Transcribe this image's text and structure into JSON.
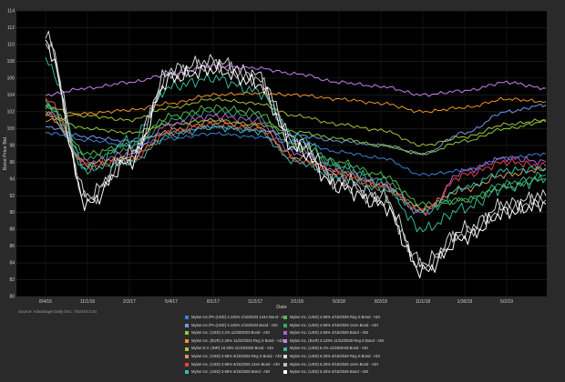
{
  "chart_data": {
    "type": "line",
    "title": "",
    "ylabel": "Bond Price Bid",
    "xlabel": "Date",
    "ylim": [
      80,
      114
    ],
    "yticks": [
      80,
      82,
      84,
      86,
      88,
      90,
      92,
      94,
      96,
      98,
      100,
      102,
      104,
      106,
      108,
      110,
      112,
      114
    ],
    "xticks": [
      "8/4/16",
      "11/1/16",
      "2/2/17",
      "5/4/17",
      "8/1/17",
      "11/2/17",
      "2/1/18",
      "5/3/18",
      "8/2/18",
      "11/1/18",
      "1/30/19",
      "5/2/19"
    ],
    "grid": true,
    "legend_placement": "bottom",
    "source": "Source: Advantage Daily Doc. 7/24/19 3:34",
    "x": [
      "8/4/16",
      "11/1/16",
      "2/2/17",
      "5/4/17",
      "8/1/17",
      "11/2/17",
      "2/1/18",
      "5/3/18",
      "8/2/18",
      "11/1/18",
      "1/30/19",
      "5/2/19",
      "7/23/19"
    ],
    "series": [
      {
        "name": "Mylan Inc./PA (USD) 3.125% 1/15/2023 144A Bond - ADI",
        "color": "#3f7fd9",
        "values": [
          99.5,
          98.6,
          98.0,
          98.8,
          99.4,
          99.0,
          98.5,
          97.2,
          96.5,
          94.5,
          95.0,
          96.5,
          97.0
        ]
      },
      {
        "name": "Mylan Inc. (USD) 4.55% 4/15/2028 Reg S Bond - ADI",
        "color": "#57b84f",
        "values": [
          103.0,
          97.0,
          98.0,
          101.5,
          102.5,
          102.0,
          98.0,
          96.0,
          94.5,
          91.0,
          91.5,
          93.0,
          94.0
        ]
      },
      {
        "name": "Mylan Inc./PA (USD) 3.125% 1/15/2023 Bond - ADI",
        "color": "#6f9ae6",
        "values": [
          100.2,
          99.0,
          98.5,
          99.5,
          100.2,
          99.8,
          99.2,
          98.5,
          98.0,
          97.0,
          99.5,
          102.0,
          102.8
        ]
      },
      {
        "name": "Mylan Inc. (USD) 4.55% 4/15/2028 144A Bond - ADI",
        "color": "#3aa86a",
        "values": [
          102.5,
          96.5,
          97.5,
          101.0,
          102.0,
          101.5,
          97.5,
          95.5,
          94.0,
          90.5,
          91.5,
          93.5,
          94.5
        ]
      },
      {
        "name": "Mylan Inc. (USD) 4.2% 11/29/2023 Bond - ADI",
        "color": "#8fc83a",
        "values": [
          101.5,
          100.0,
          99.5,
          100.5,
          101.0,
          100.5,
          99.6,
          98.8,
          98.0,
          97.0,
          98.5,
          100.0,
          100.8
        ]
      },
      {
        "name": "Mylan Inc. (USD) 4.55% 4/15/2028 Bond - ADI",
        "color": "#b060d6",
        "values": [
          102.0,
          96.0,
          97.0,
          100.5,
          101.5,
          101.0,
          97.0,
          95.0,
          93.5,
          90.0,
          95.0,
          96.5,
          96.0
        ]
      },
      {
        "name": "Mylan Inc. (EUR) 2.25% 11/22/2024 Reg S Bond - ADI",
        "color": "#f0932a",
        "values": [
          101.0,
          101.8,
          102.2,
          103.0,
          104.0,
          104.2,
          104.0,
          103.5,
          103.0,
          102.0,
          102.5,
          103.5,
          103.2
        ]
      },
      {
        "name": "Mylan Inc. (EUR) 3.125% 11/22/2028 Reg S Bond - ADI",
        "color": "#c87ff0",
        "values": [
          104.0,
          104.8,
          105.5,
          106.5,
          107.5,
          107.2,
          106.5,
          105.5,
          105.0,
          104.0,
          104.5,
          105.5,
          104.8
        ]
      },
      {
        "name": "Mylan N.V. (INR) 10.25% 11/10/2025 Bond - ADI",
        "color": "#a6c23a",
        "values": [
          102.5,
          101.5,
          101.0,
          102.5,
          103.5,
          103.0,
          101.5,
          100.5,
          99.8,
          98.0,
          99.0,
          100.5,
          101.0
        ]
      },
      {
        "name": "Mylan Inc. (USD) 5.4% 11/29/2043 Bond - ADI",
        "color": "#35b89a",
        "values": [
          108.0,
          95.0,
          98.5,
          105.0,
          106.0,
          104.5,
          99.0,
          95.5,
          93.5,
          88.0,
          90.5,
          93.0,
          94.0
        ]
      },
      {
        "name": "Mylan Inc. (USD) 3.95% 6/15/2026 Reg S Bond - ADI",
        "color": "#d49b5a",
        "values": [
          101.8,
          95.8,
          96.5,
          99.8,
          100.8,
          100.3,
          96.5,
          94.8,
          93.2,
          90.5,
          92.8,
          94.5,
          95.2
        ]
      },
      {
        "name": "Mylan Inc. (USD) 5.25% 6/15/2046 Reg S Bond - ADI",
        "color": "#d7d7d7",
        "values": [
          111.0,
          92.0,
          97.0,
          107.0,
          108.0,
          106.5,
          98.5,
          94.0,
          92.0,
          84.0,
          88.0,
          91.0,
          92.0
        ]
      },
      {
        "name": "Mylan Inc. (USD) 3.95% 6/15/2026 144A Bond - ADI",
        "color": "#e8453c",
        "values": [
          103.5,
          95.5,
          96.2,
          99.5,
          100.5,
          100.0,
          96.2,
          94.5,
          93.0,
          90.2,
          94.5,
          96.0,
          95.5
        ]
      },
      {
        "name": "Mylan Inc. (USD) 5.25% 6/15/2046 144A Bond - ADI",
        "color": "#bfbfbf",
        "values": [
          110.5,
          91.5,
          96.5,
          106.5,
          107.5,
          106.0,
          98.0,
          93.5,
          91.5,
          83.5,
          87.5,
          90.5,
          91.5
        ]
      },
      {
        "name": "Mylan Inc. (USD) 3.95% 6/15/2026 Bond - ADI",
        "color": "#2fbfb0",
        "values": [
          103.0,
          95.2,
          96.0,
          99.2,
          100.2,
          99.7,
          96.0,
          94.2,
          92.8,
          90.0,
          93.0,
          95.0,
          95.3
        ]
      },
      {
        "name": "Mylan Inc. (USD) 5.25% 6/15/2046 Bond - ADI",
        "color": "#ffffff",
        "values": [
          110.0,
          91.0,
          96.0,
          106.0,
          107.0,
          105.5,
          97.5,
          93.0,
          91.0,
          83.0,
          87.0,
          90.0,
          91.0
        ]
      }
    ]
  }
}
